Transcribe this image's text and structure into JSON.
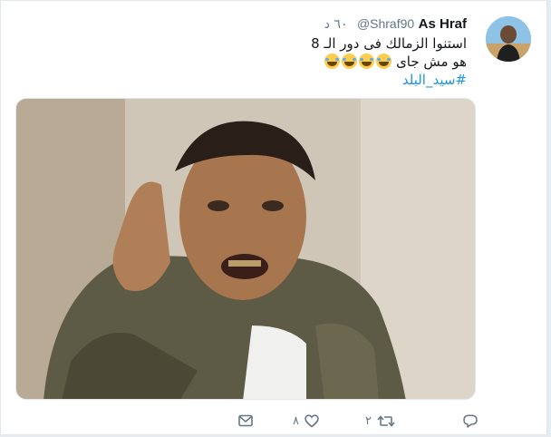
{
  "tweet": {
    "display_name": "As Hraf",
    "handle": "@Shraf90",
    "time": "٦٠ د",
    "lines": [
      "استنوا الزمالك فى دور الـ 8",
      "هو مش جاى"
    ],
    "emoji_count": 4,
    "hashtag": "#سيد_البلد"
  },
  "actions": {
    "reply_count": "",
    "retweet_count": "٢",
    "like_count": "٨"
  },
  "icons": {
    "reply": "reply-icon",
    "retweet": "retweet-icon",
    "like": "heart-icon",
    "dm": "envelope-icon"
  },
  "colors": {
    "accent": "#1b95e0",
    "text": "#14171a",
    "muted": "#657786"
  }
}
